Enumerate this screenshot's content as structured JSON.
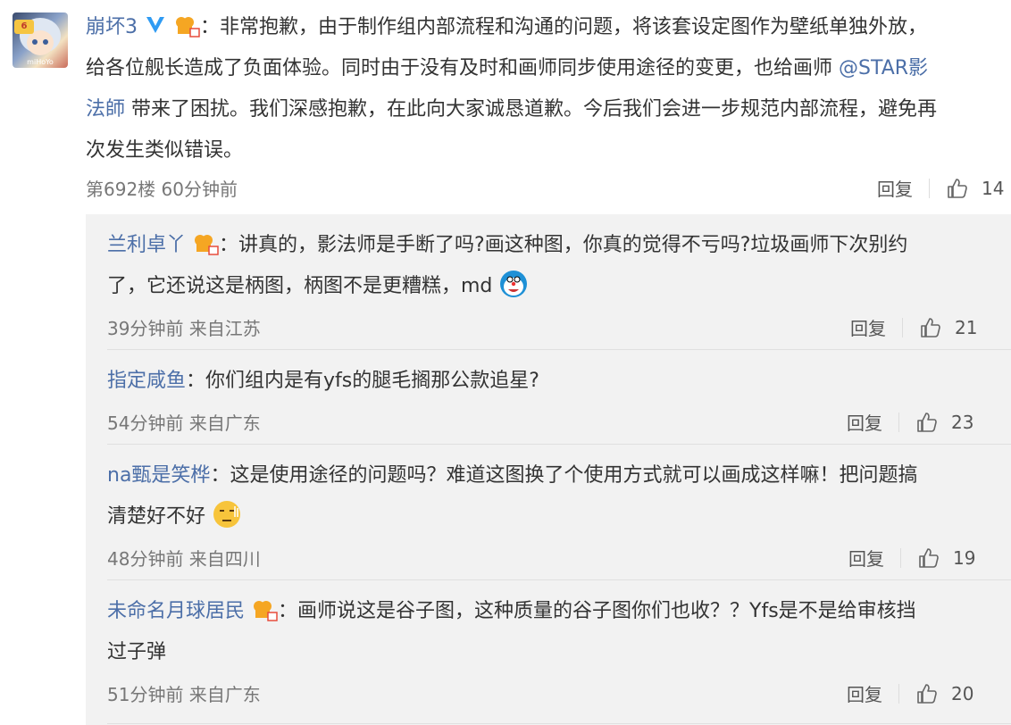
{
  "main_comment": {
    "user": "崩坏3",
    "lines": [
      "：非常抱歉，由于制作组内部流程和沟通的问题，将该套设定图作为壁纸单独外放，",
      "给各位舰长造成了负面体验。同时由于没有及时和画师同步使用途径的变更，也给画师",
      "带来了困扰。我们深感抱歉，在此向大家诚恳道歉。今后我们会进一步规范内部流程，避免再",
      "次发生类似错误。"
    ],
    "mention_part1": "@STAR影",
    "mention_part2": "法師",
    "floor": "第692楼 60分钟前",
    "reply_label": "回复",
    "likes": "14"
  },
  "replies": [
    {
      "user": "兰利卓丫",
      "line1": "：讲真的，影法师是手断了吗?画这种图，你真的觉得不亏吗?垃圾画师下次别约",
      "line2": "了，它还说这是柄图，柄图不是更糟糕，md",
      "meta": "39分钟前 来自江苏",
      "reply_label": "回复",
      "likes": "21"
    },
    {
      "user": "指定咸鱼",
      "line1": "：你们组内是有yfs的腿毛搁那公款追星?",
      "line2": "",
      "meta": "54分钟前 来自广东",
      "reply_label": "回复",
      "likes": "23"
    },
    {
      "user": "na甄是笑桦",
      "line1": "：这是使用途径的问题吗？难道这图换了个使用方式就可以画成这样嘛！把问题搞",
      "line2": "清楚好不好",
      "meta": "48分钟前 来自四川",
      "reply_label": "回复",
      "likes": "19"
    },
    {
      "user": "未命名月球居民",
      "line1": "：画师说这是谷子图，这种质量的谷子图你们也收？？Yfs是不是给审核挡",
      "line2": "过子弹",
      "meta": "51分钟前 来自广东",
      "reply_label": "回复",
      "likes": "20"
    }
  ],
  "colors": {
    "link": "#4c6fa8",
    "reply_bg": "#f2f2f2",
    "vip_blue": "#2f9bf3",
    "crown": "#f5a623"
  },
  "icons": {
    "verified": "verified-v-icon",
    "crown": "crown-badge-icon",
    "like": "thumbs-up-icon"
  }
}
